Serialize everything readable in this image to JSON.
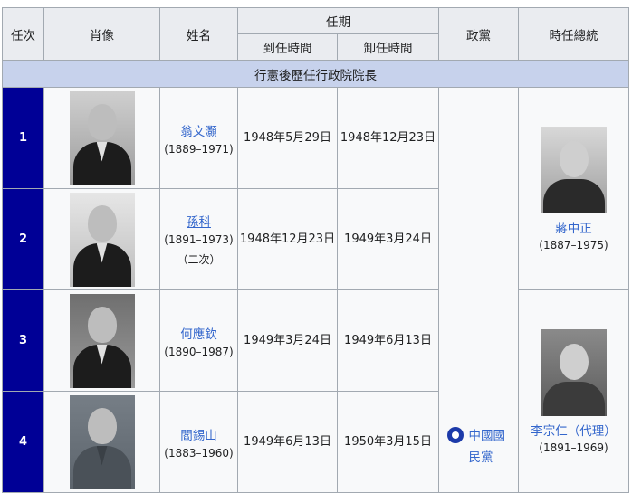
{
  "headers": {
    "term": "任次",
    "portrait": "肖像",
    "name": "姓名",
    "tenure": "任期",
    "start": "到任時間",
    "end": "卸任時間",
    "party": "政黨",
    "president": "時任總統"
  },
  "section_title": "行憲後歷任行政院院長",
  "party_name": "中國國民黨",
  "rows": [
    {
      "num": "1",
      "name": "翁文灝",
      "years": "(1889–1971)",
      "note": "",
      "start": "1948年5月29日",
      "end": "1948年12月23日"
    },
    {
      "num": "2",
      "name": "孫科",
      "years": "(1891–1973)",
      "note": "（二次）",
      "start": "1948年12月23日",
      "end": "1949年3月24日"
    },
    {
      "num": "3",
      "name": "何應欽",
      "years": "(1890–1987)",
      "note": "",
      "start": "1949年3月24日",
      "end": "1949年6月13日"
    },
    {
      "num": "4",
      "name": "閻錫山",
      "years": "(1883–1960)",
      "note": "",
      "start": "1949年6月13日",
      "end": "1950年3月15日"
    }
  ],
  "presidents": [
    {
      "name": "蔣中正",
      "years": "(1887–1975)"
    },
    {
      "name": "李宗仁（代理）",
      "years": "(1891–1969)"
    }
  ]
}
